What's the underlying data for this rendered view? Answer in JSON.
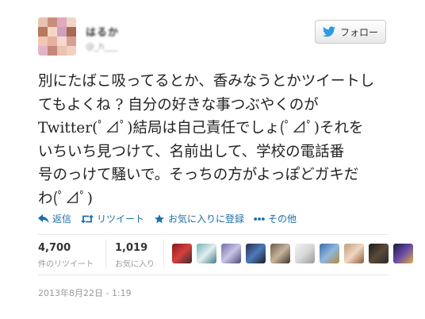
{
  "user": {
    "display_name": "はるか",
    "screen_name": "@_h___"
  },
  "follow_button": {
    "label": "フォロー",
    "icon": "twitter-bird-icon"
  },
  "tweet": {
    "lines": [
      "別にたばこ吸ってるとか、香みなうとかツイートし",
      "てもよくね ? 自分の好きな事つぶやくのが",
      "Twitter(ﾟ⊿ﾟ)結局は自己責任でしょ(ﾟ⊿ﾟ)それを",
      "いちいち見つけて、名前出して、学校の電話番",
      "号のっけて騒いで。そっちの方がよっぽどガキだ",
      "わ(ﾟ⊿ﾟ)"
    ]
  },
  "actions": [
    {
      "label": "返信",
      "icon": "reply-icon"
    },
    {
      "label": "リツイート",
      "icon": "retweet-icon"
    },
    {
      "label": "お気に入りに登録",
      "icon": "star-icon"
    },
    {
      "label": "その他",
      "icon": "more-icon"
    }
  ],
  "stats": {
    "retweets": {
      "count": "4,700",
      "label": "件のリツイート"
    },
    "favorites": {
      "count": "1,019",
      "label": "お気に入り"
    }
  },
  "favoriters_count_shown": 10,
  "timestamp": "2013年8月22日 - 1:19",
  "colors": {
    "link": "#1c6fa8",
    "twitter_blue": "#2b9be5"
  }
}
